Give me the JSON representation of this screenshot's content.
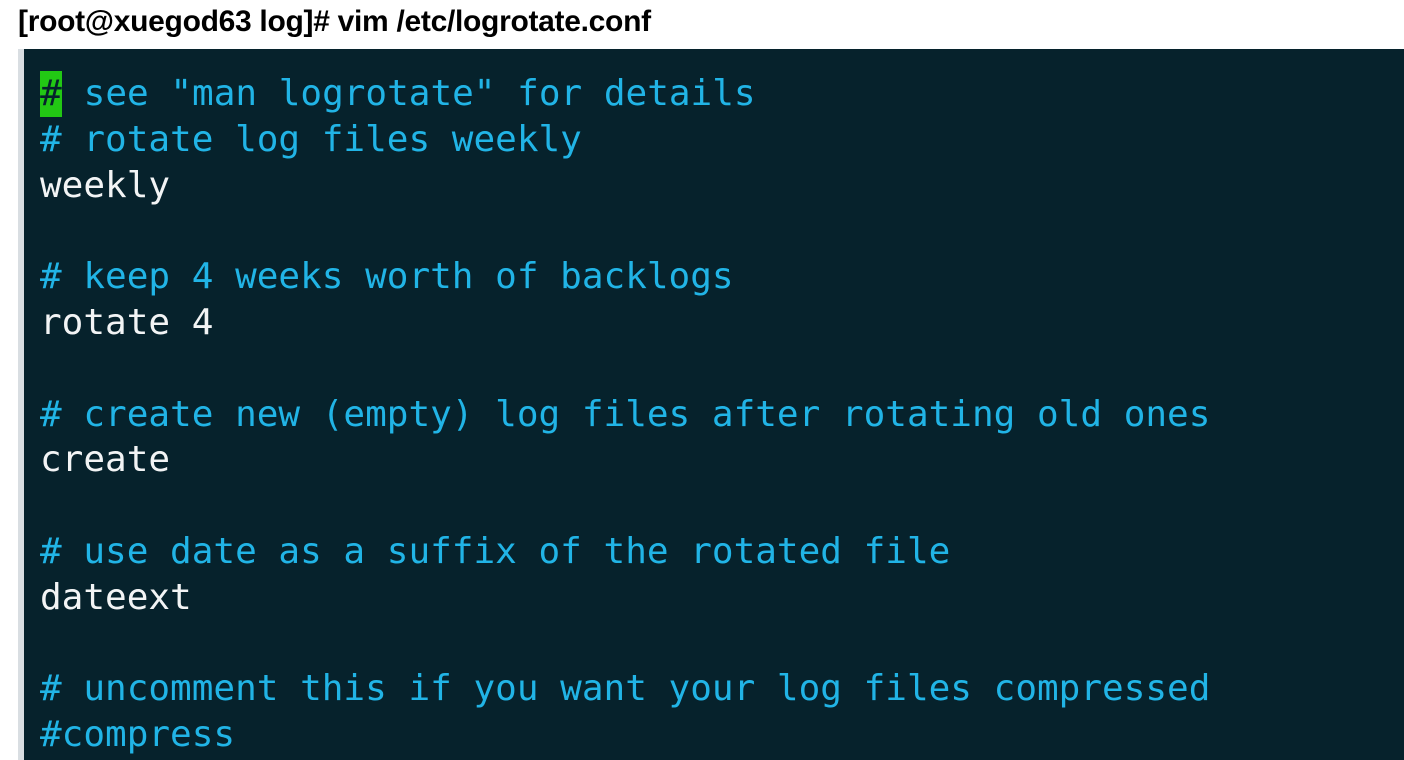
{
  "shell": {
    "prompt": "[root@xuegod63 log]#",
    "command": "vim /etc/logrotate.conf"
  },
  "editor": {
    "cursor_char": "#",
    "first_line_rest": " see \"man logrotate\" for details",
    "lines": [
      {
        "text": "# rotate log files weekly",
        "kind": "comment"
      },
      {
        "text": "weekly",
        "kind": "directive"
      },
      {
        "text": "",
        "kind": "blank"
      },
      {
        "text": "# keep 4 weeks worth of backlogs",
        "kind": "comment"
      },
      {
        "text": "rotate 4",
        "kind": "directive"
      },
      {
        "text": "",
        "kind": "blank"
      },
      {
        "text": "# create new (empty) log files after rotating old ones",
        "kind": "comment"
      },
      {
        "text": "create",
        "kind": "directive"
      },
      {
        "text": "",
        "kind": "blank"
      },
      {
        "text": "# use date as a suffix of the rotated file",
        "kind": "comment"
      },
      {
        "text": "dateext",
        "kind": "directive"
      },
      {
        "text": "",
        "kind": "blank"
      },
      {
        "text": "# uncomment this if you want your log files compressed",
        "kind": "comment"
      },
      {
        "text": "#compress",
        "kind": "comment"
      }
    ]
  },
  "colors": {
    "background": "#06222c",
    "comment": "#21b4e6",
    "directive": "#f2f4f5",
    "cursor": "#22c814"
  }
}
